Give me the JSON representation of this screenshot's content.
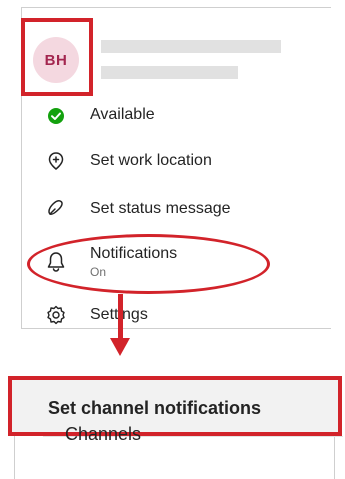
{
  "profile": {
    "initials": "BH",
    "avatar_colors": {
      "bg": "#f4d8e0",
      "fg": "#a3264f"
    }
  },
  "menu": {
    "items": [
      {
        "label": "Available",
        "icon": "available-check-icon"
      },
      {
        "label": "Set work location",
        "icon": "add-location-icon"
      },
      {
        "label": "Set status message",
        "icon": "edit-status-icon"
      },
      {
        "label": "Notifications",
        "sublabel": "On",
        "icon": "bell-icon"
      },
      {
        "label": "Settings",
        "icon": "gear-icon"
      }
    ]
  },
  "channel_panel": {
    "title": "Set channel notifications",
    "items": [
      {
        "label": "Channels"
      }
    ]
  },
  "colors": {
    "highlight": "#d2232a",
    "available": "#13a10e"
  }
}
